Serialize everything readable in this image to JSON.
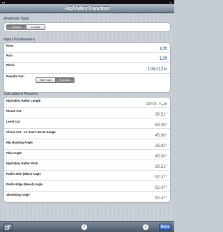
{
  "nav": {
    "title": "Hip/Valley Function"
  },
  "analysis": {
    "header": "Analysis Type",
    "options": [
      "Regular",
      "Irregular"
    ],
    "selected": "Regular"
  },
  "inputs": {
    "header": "Input Parameters",
    "rise_label": "Rise:",
    "rise_value": "10ft",
    "run_label": "Run:",
    "run_value": "12ft",
    "pitch_label": "Pitch:",
    "pitch_value": "10in/12in",
    "results_for_label": "Results For:",
    "results_for_options": [
      "Miter Saw",
      "Protractor"
    ],
    "results_for_selected": "Protractor"
  },
  "results": {
    "header": "Calculated Results",
    "items": [
      {
        "label": "Hip/Valley Rafter Length",
        "value": "19ft 8- ³⁄₁₆in"
      },
      {
        "label": "Plumb Cut",
        "value": "30.51°"
      },
      {
        "label": "Level Cut",
        "value": "59.49°"
      },
      {
        "label": "Check Cut - on Saw's Bevel Gauge",
        "value": "45.00°"
      },
      {
        "label": "Hip Backing Angle",
        "value": "26.92°"
      },
      {
        "label": "Plan Angle",
        "value": "45.00°"
      },
      {
        "label": "Hip/Valley Rafter Pitch",
        "value": "30.51°"
      },
      {
        "label": "Purlin Side (Miter) Angle",
        "value": "57.37°"
      },
      {
        "label": "Purlin Edge (Bevel) Angle",
        "value": "52.47°"
      },
      {
        "label": "Sheathing Angle",
        "value": "52.47°"
      }
    ]
  },
  "toolbar": {
    "done_label": "Done"
  }
}
